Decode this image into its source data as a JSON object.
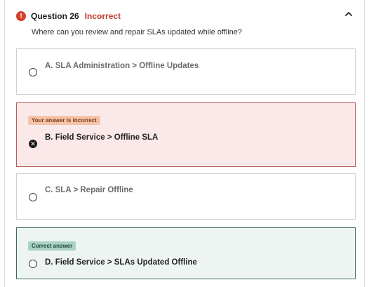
{
  "question": {
    "number_label": "Question 26",
    "status_label": "Incorrect",
    "prompt": "Where can you review and repair SLAs updated while offline?",
    "alert_icon": "exclamation-icon",
    "collapse_icon": "chevron-up-icon"
  },
  "options": [
    {
      "label": "A. SLA Administration > Offline Updates",
      "state": "unselected"
    },
    {
      "label": "B. Field Service > Offline SLA",
      "state": "selected-incorrect",
      "badge": "Your answer is incorrect"
    },
    {
      "label": "C. SLA > Repair Offline",
      "state": "unselected"
    },
    {
      "label": "D. Field Service > SLAs Updated Offline",
      "state": "correct",
      "badge": "Correct answer"
    }
  ],
  "colors": {
    "incorrect_accent": "#c0392b",
    "incorrect_bg": "#fbe9e9",
    "correct_bg": "#eef4f1",
    "incorrect_badge": "#f6c3a8",
    "correct_badge": "#a8d2c4"
  }
}
